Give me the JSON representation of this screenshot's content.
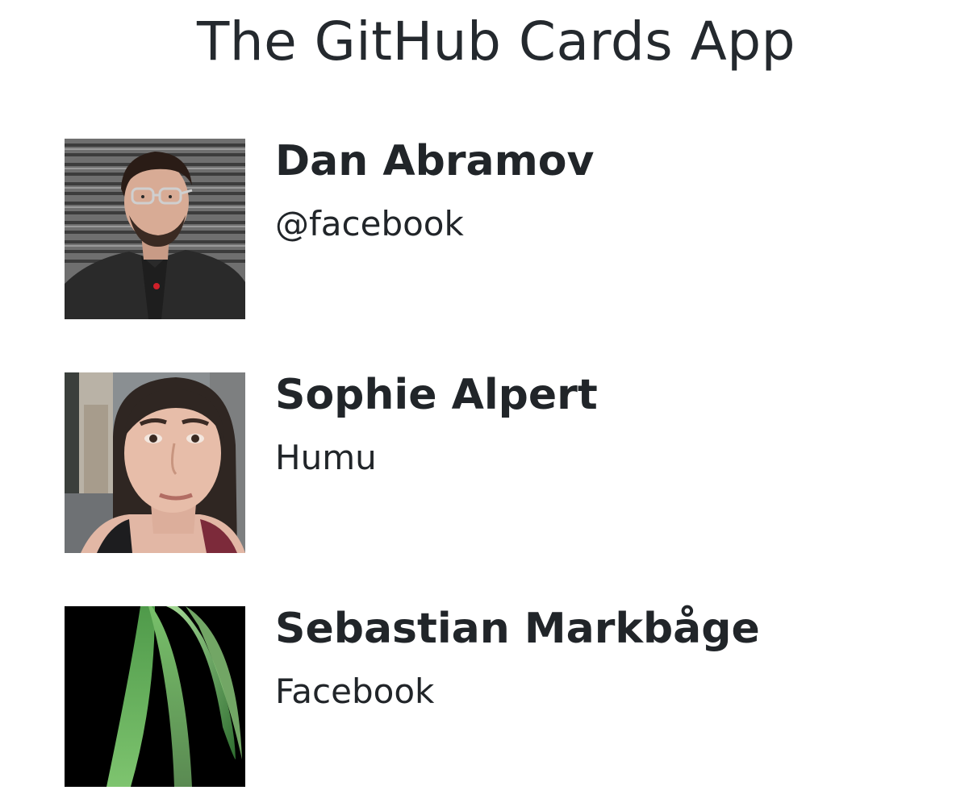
{
  "app": {
    "title": "The GitHub Cards App"
  },
  "cards": [
    {
      "name": "Dan Abramov",
      "company": "@facebook",
      "avatar_icon": "avatar-photo"
    },
    {
      "name": "Sophie Alpert",
      "company": "Humu",
      "avatar_icon": "avatar-photo"
    },
    {
      "name": "Sebastian Markbåge",
      "company": "Facebook",
      "avatar_icon": "avatar-leaf-logo"
    }
  ]
}
